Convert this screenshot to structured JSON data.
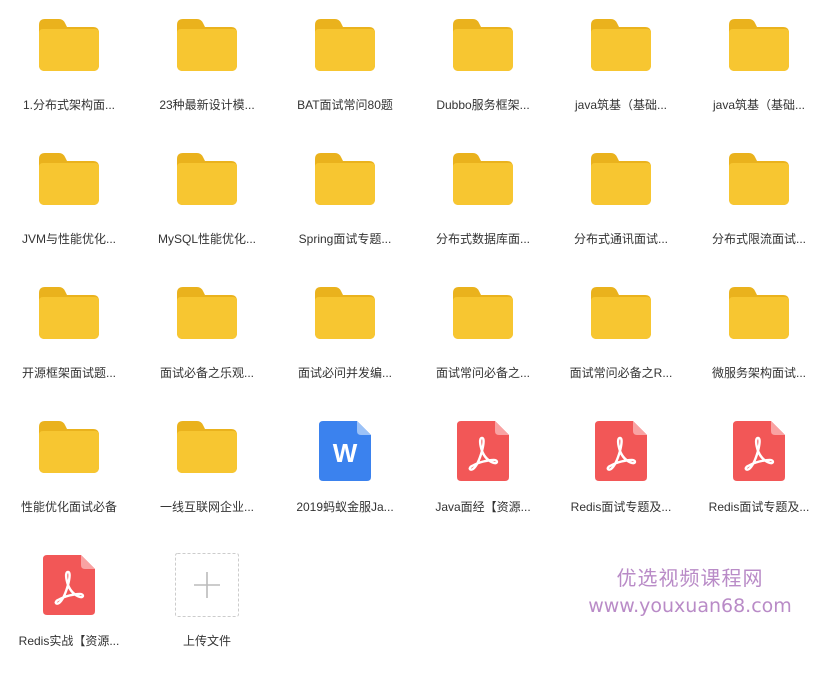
{
  "items": [
    {
      "type": "folder",
      "label": "1.分布式架构面..."
    },
    {
      "type": "folder",
      "label": "23种最新设计模..."
    },
    {
      "type": "folder",
      "label": "BAT面试常问80题"
    },
    {
      "type": "folder",
      "label": "Dubbo服务框架..."
    },
    {
      "type": "folder",
      "label": "java筑基（基础..."
    },
    {
      "type": "folder",
      "label": "java筑基（基础..."
    },
    {
      "type": "folder",
      "label": "JVM与性能优化..."
    },
    {
      "type": "folder",
      "label": "MySQL性能优化..."
    },
    {
      "type": "folder",
      "label": "Spring面试专题..."
    },
    {
      "type": "folder",
      "label": "分布式数据库面..."
    },
    {
      "type": "folder",
      "label": "分布式通讯面试..."
    },
    {
      "type": "folder",
      "label": "分布式限流面试..."
    },
    {
      "type": "folder",
      "label": "开源框架面试题..."
    },
    {
      "type": "folder",
      "label": "面试必备之乐观..."
    },
    {
      "type": "folder",
      "label": "面试必问并发编..."
    },
    {
      "type": "folder",
      "label": "面试常问必备之..."
    },
    {
      "type": "folder",
      "label": "面试常问必备之R..."
    },
    {
      "type": "folder",
      "label": "微服务架构面试..."
    },
    {
      "type": "folder",
      "label": "性能优化面试必备"
    },
    {
      "type": "folder",
      "label": "一线互联网企业..."
    },
    {
      "type": "word",
      "label": "2019蚂蚁金服Ja..."
    },
    {
      "type": "pdf",
      "label": "Java面经【资源..."
    },
    {
      "type": "pdf",
      "label": "Redis面试专题及..."
    },
    {
      "type": "pdf",
      "label": "Redis面试专题及..."
    },
    {
      "type": "pdf",
      "label": "Redis实战【资源..."
    },
    {
      "type": "upload",
      "label": "上传文件"
    }
  ],
  "watermark": {
    "chinese": "优选视频课程网",
    "url": "www.youxuan68.com"
  },
  "colors": {
    "folder": "#f7c631",
    "folder_tab": "#eab21d",
    "word": "#3b82ee",
    "pdf": "#f25757",
    "upload_border": "#cccccc",
    "watermark": "#b98bc7"
  }
}
